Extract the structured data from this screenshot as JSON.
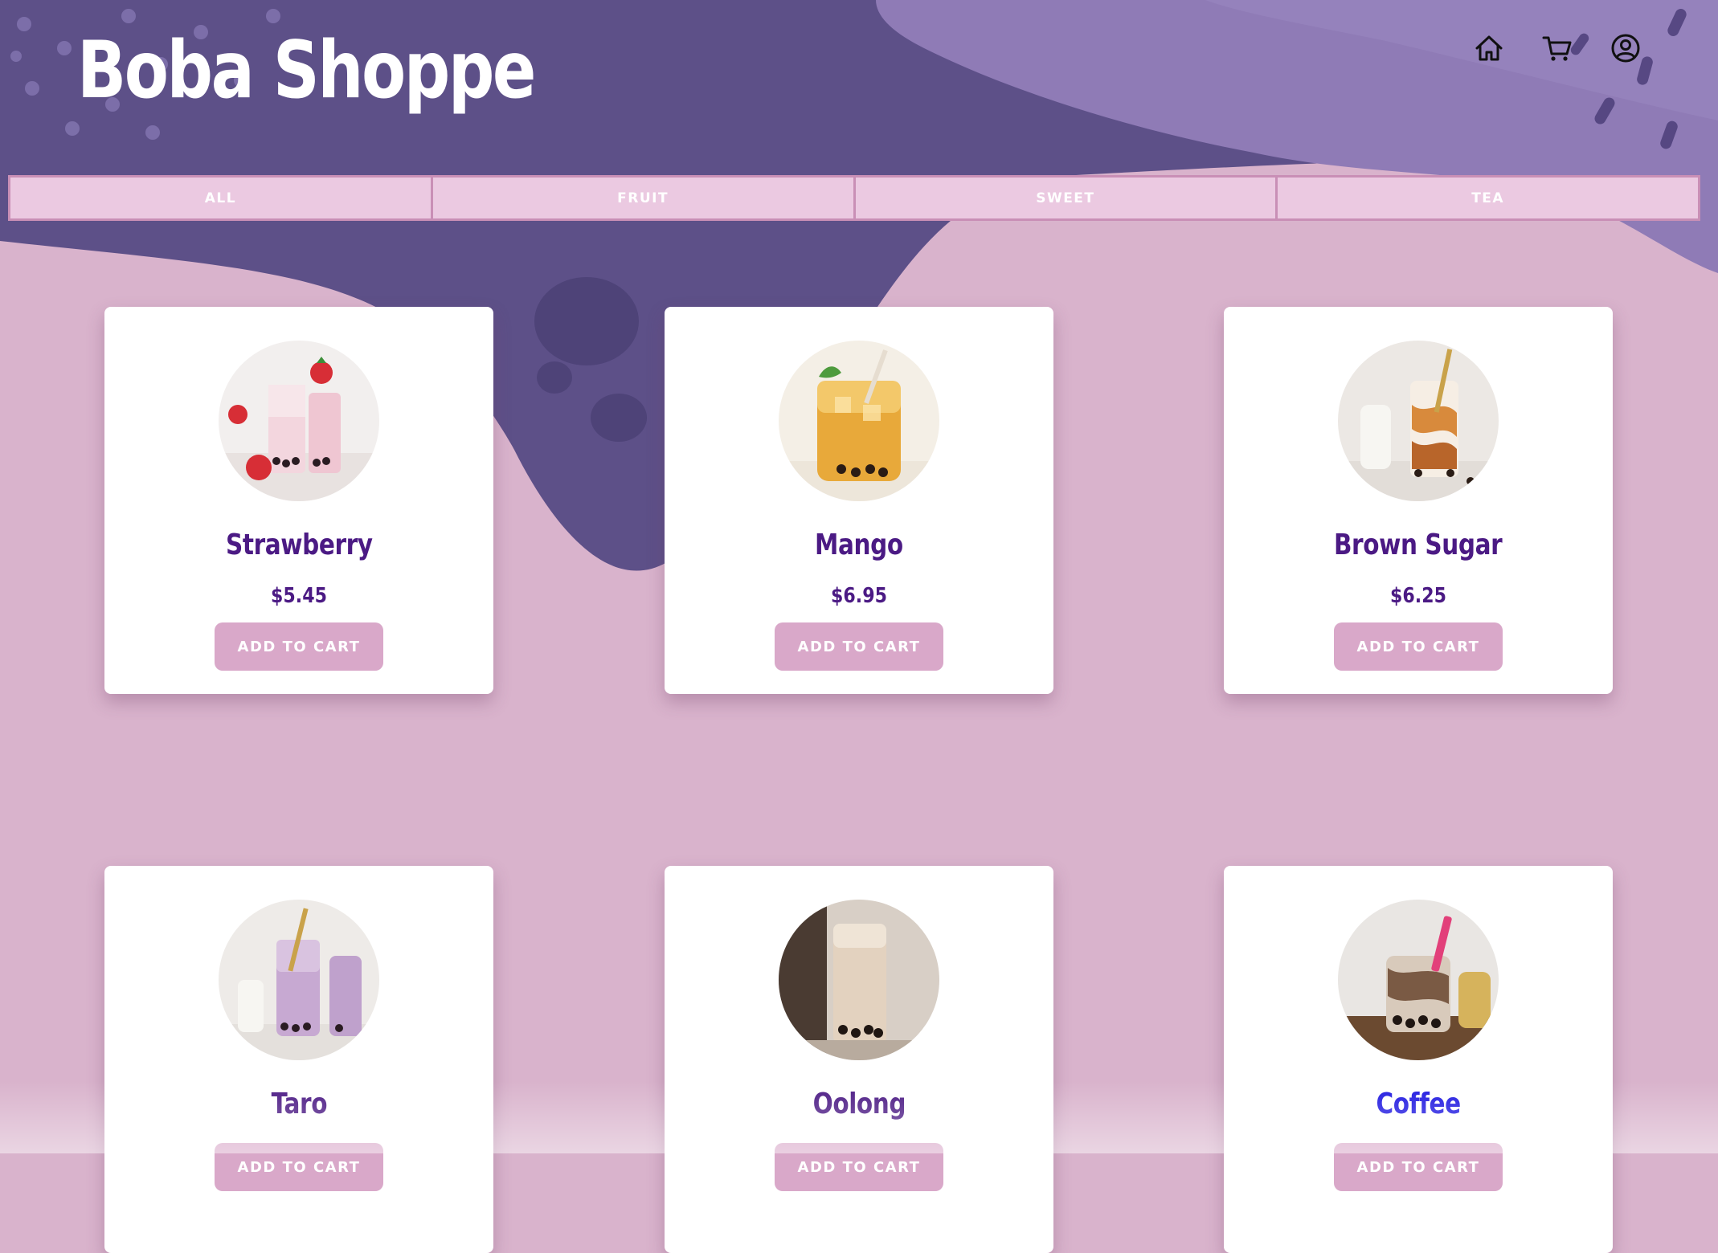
{
  "header": {
    "brand": "Boba Shoppe",
    "icons": [
      "home-icon",
      "cart-icon",
      "account-icon"
    ]
  },
  "tabs": [
    {
      "label": "ALL"
    },
    {
      "label": "FRUIT"
    },
    {
      "label": "SWEET"
    },
    {
      "label": "TEA"
    }
  ],
  "products": [
    {
      "name": "Strawberry",
      "price": "$5.45",
      "button": "ADD TO CART"
    },
    {
      "name": "Mango",
      "price": "$6.95",
      "button": "ADD TO CART"
    },
    {
      "name": "Brown Sugar",
      "price": "$6.25",
      "button": "ADD TO CART"
    },
    {
      "name": "Taro",
      "price": "",
      "button": "ADD TO CART"
    },
    {
      "name": "Oolong",
      "price": "",
      "button": "ADD TO CART"
    },
    {
      "name": "Coffee",
      "price": "",
      "button": "ADD TO CART"
    }
  ],
  "colors": {
    "page_background": "#d9b3cc",
    "header_purple": "#6b5b9c",
    "tab_background": "#ebc9e1",
    "title_text": "#4b1a84",
    "button": "#d9a8c9",
    "link_text": "#1f18e0"
  }
}
